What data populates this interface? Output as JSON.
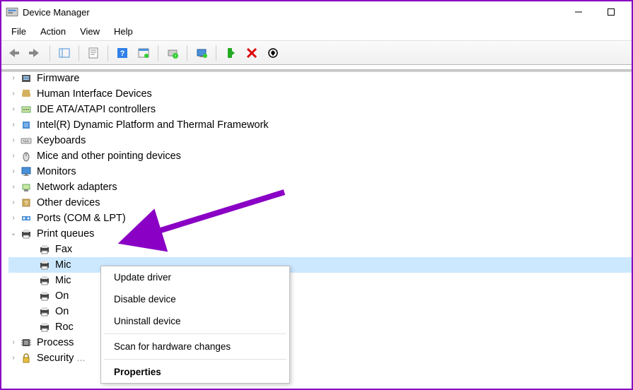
{
  "window": {
    "title": "Device Manager"
  },
  "menubar": [
    "File",
    "Action",
    "View",
    "Help"
  ],
  "tree": {
    "items": [
      {
        "label": "Firmware",
        "icon": "firmware"
      },
      {
        "label": "Human Interface Devices",
        "icon": "hid"
      },
      {
        "label": "IDE ATA/ATAPI controllers",
        "icon": "ide"
      },
      {
        "label": "Intel(R) Dynamic Platform and Thermal Framework",
        "icon": "intel"
      },
      {
        "label": "Keyboards",
        "icon": "keyboard"
      },
      {
        "label": "Mice and other pointing devices",
        "icon": "mouse"
      },
      {
        "label": "Monitors",
        "icon": "monitor"
      },
      {
        "label": "Network adapters",
        "icon": "network"
      },
      {
        "label": "Other devices",
        "icon": "other"
      },
      {
        "label": "Ports (COM & LPT)",
        "icon": "ports"
      }
    ],
    "expanded": {
      "label": "Print queues",
      "children": [
        {
          "label": "Fax"
        },
        {
          "label": "Mic",
          "selected": true
        },
        {
          "label": "Mic"
        },
        {
          "label": "On"
        },
        {
          "label": "On"
        },
        {
          "label": "Roc"
        }
      ]
    },
    "after": [
      {
        "label": "Process",
        "icon": "cpu"
      },
      {
        "label": "Security",
        "icon": "security",
        "truncated": true
      }
    ]
  },
  "context_menu": {
    "items": [
      {
        "label": "Update driver",
        "highlighted": true
      },
      {
        "label": "Disable device"
      },
      {
        "label": "Uninstall device"
      },
      {
        "separator": true
      },
      {
        "label": "Scan for hardware changes"
      },
      {
        "separator": true
      },
      {
        "label": "Properties",
        "bold": true
      }
    ]
  },
  "annotation": {
    "color": "#8a00c4"
  }
}
